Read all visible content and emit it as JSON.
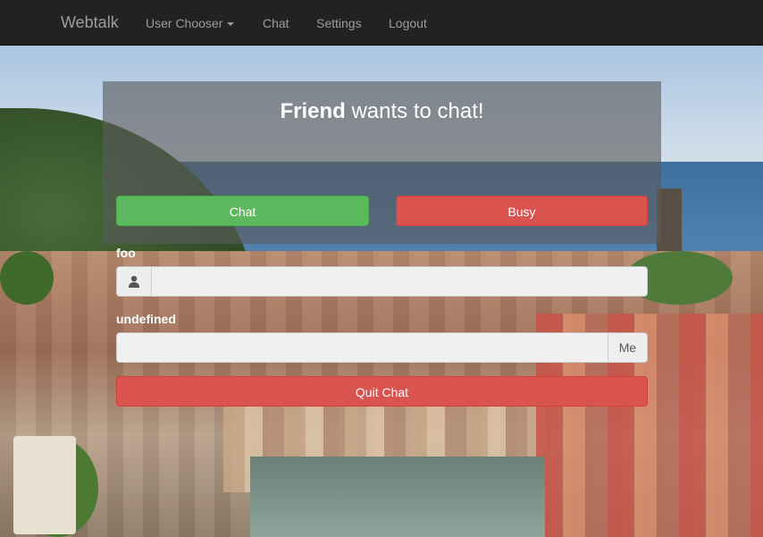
{
  "navbar": {
    "brand": "Webtalk",
    "items": [
      {
        "label": "User Chooser",
        "dropdown": true
      },
      {
        "label": "Chat"
      },
      {
        "label": "Settings"
      },
      {
        "label": "Logout"
      }
    ]
  },
  "invite": {
    "friend_name": "Friend",
    "message": " wants to chat!",
    "chat_button": "Chat",
    "busy_button": "Busy"
  },
  "chat": {
    "user_label": "foo",
    "user_icon": "user-icon",
    "user_value": "",
    "message_label": "undefined",
    "message_value": "",
    "me_button": "Me",
    "quit_button": "Quit Chat"
  },
  "colors": {
    "navbar_bg": "#222222",
    "success": "#5cb85c",
    "danger": "#d9534f"
  }
}
